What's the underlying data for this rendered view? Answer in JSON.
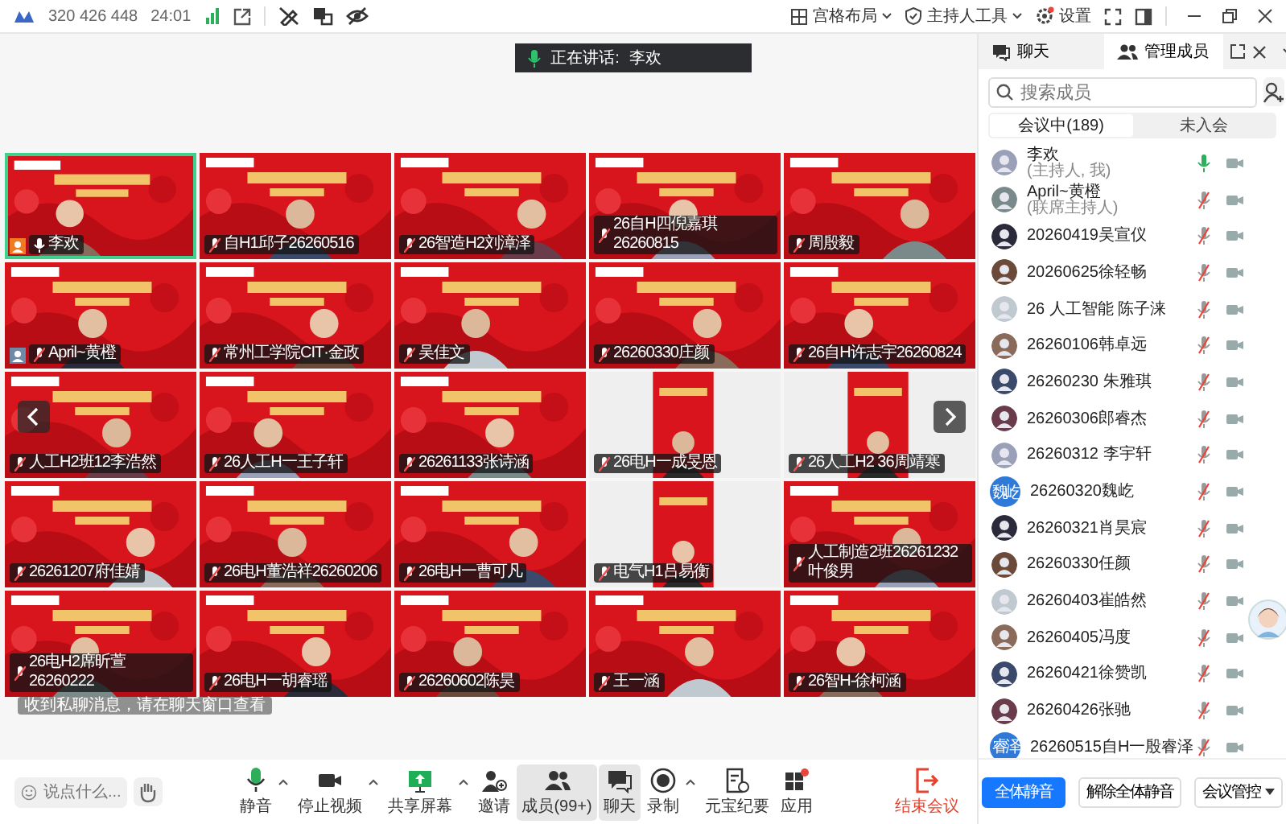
{
  "top_bar": {
    "meeting_id": "320 426 448",
    "duration": "24:01",
    "menus": [
      {
        "kind": "grid",
        "label": "宫格布局",
        "caret": true
      },
      {
        "kind": "shield",
        "label": "主持人工具",
        "caret": true
      },
      {
        "kind": "gear",
        "label": "设置",
        "caret": false
      }
    ]
  },
  "speaking": {
    "label": "正在讲话:",
    "name": "李欢"
  },
  "tiles": [
    {
      "name": "李欢",
      "kind": "full",
      "selected": true,
      "host": true,
      "cohost": false,
      "muted": false
    },
    {
      "name": "自H1邱子26260516",
      "kind": "full",
      "selected": false,
      "host": false,
      "cohost": false,
      "muted": true
    },
    {
      "name": "26智造H2刘漳泽",
      "kind": "full",
      "selected": false,
      "host": false,
      "cohost": false,
      "muted": true
    },
    {
      "name": "26自H四倪嘉琪26260815",
      "kind": "full",
      "selected": false,
      "host": false,
      "cohost": false,
      "muted": true
    },
    {
      "name": "周殷毅",
      "kind": "full",
      "selected": false,
      "host": false,
      "cohost": false,
      "muted": true
    },
    {
      "name": "April~黄橙",
      "kind": "full",
      "selected": false,
      "host": false,
      "cohost": true,
      "muted": true
    },
    {
      "name": "常州工学院CIT·金政",
      "kind": "full",
      "selected": false,
      "host": false,
      "cohost": false,
      "muted": true
    },
    {
      "name": "吴佳文",
      "kind": "full",
      "selected": false,
      "host": false,
      "cohost": false,
      "muted": true
    },
    {
      "name": "26260330庄颜",
      "kind": "full",
      "selected": false,
      "host": false,
      "cohost": false,
      "muted": true
    },
    {
      "name": "26自H许志宇26260824",
      "kind": "full",
      "selected": false,
      "host": false,
      "cohost": false,
      "muted": true
    },
    {
      "name": "人工H2班12李浩然",
      "kind": "full",
      "selected": false,
      "host": false,
      "cohost": false,
      "muted": true
    },
    {
      "name": "26人工H一王子轩",
      "kind": "full",
      "selected": false,
      "host": false,
      "cohost": false,
      "muted": true
    },
    {
      "name": "26261133张诗涵",
      "kind": "full",
      "selected": false,
      "host": false,
      "cohost": false,
      "muted": true
    },
    {
      "name": "26电H一成旻恩",
      "kind": "narrow",
      "selected": false,
      "host": false,
      "cohost": false,
      "muted": true
    },
    {
      "name": "26人工H2 36周靖寒",
      "kind": "narrow",
      "selected": false,
      "host": false,
      "cohost": false,
      "muted": true
    },
    {
      "name": "26261207府佳婧",
      "kind": "full",
      "selected": false,
      "host": false,
      "cohost": false,
      "muted": true
    },
    {
      "name": "26电H董浩祥26260206",
      "kind": "full",
      "selected": false,
      "host": false,
      "cohost": false,
      "muted": true
    },
    {
      "name": "26电H一曹可凡",
      "kind": "full",
      "selected": false,
      "host": false,
      "cohost": false,
      "muted": true
    },
    {
      "name": "电气H1吕易衡",
      "kind": "narrow",
      "selected": false,
      "host": false,
      "cohost": false,
      "muted": true
    },
    {
      "name": "人工制造2班26261232叶俊男",
      "kind": "full",
      "selected": false,
      "host": false,
      "cohost": false,
      "muted": true
    },
    {
      "name": "26电H2席昕萱26260222",
      "kind": "full",
      "selected": false,
      "host": false,
      "cohost": false,
      "muted": true
    },
    {
      "name": "26电H一胡睿瑶",
      "kind": "full",
      "selected": false,
      "host": false,
      "cohost": false,
      "muted": true
    },
    {
      "name": "26260602陈昊",
      "kind": "full",
      "selected": false,
      "host": false,
      "cohost": false,
      "muted": true
    },
    {
      "name": "王一涵",
      "kind": "full",
      "selected": false,
      "host": false,
      "cohost": false,
      "muted": true
    },
    {
      "name": "26智H-徐柯涵",
      "kind": "full",
      "selected": false,
      "host": false,
      "cohost": false,
      "muted": true
    }
  ],
  "toast": "收到私聊消息，请在聊天窗口查看",
  "toolbar": {
    "comment_placeholder": "说点什么...",
    "buttons": [
      {
        "kind": "mic",
        "label": "静音",
        "caret": true,
        "selected": false
      },
      {
        "kind": "video",
        "label": "停止视频",
        "caret": true,
        "selected": false
      },
      {
        "kind": "share",
        "label": "共享屏幕",
        "caret": true,
        "selected": false
      },
      {
        "kind": "invite",
        "label": "邀请",
        "caret": false,
        "selected": false
      },
      {
        "kind": "members",
        "label": "成员(99+)",
        "caret": false,
        "selected": true
      },
      {
        "kind": "chat",
        "label": "聊天",
        "caret": false,
        "selected": true
      },
      {
        "kind": "record",
        "label": "录制",
        "caret": true,
        "selected": false
      },
      {
        "kind": "notes",
        "label": "元宝纪要",
        "caret": false,
        "selected": false
      },
      {
        "kind": "apps",
        "label": "应用",
        "caret": false,
        "selected": false,
        "dot": true
      }
    ],
    "end": "结束会议"
  },
  "panel": {
    "tabs": [
      {
        "kind": "chat",
        "label": "聊天",
        "selected": false
      },
      {
        "kind": "members",
        "label": "管理成员",
        "selected": true
      }
    ],
    "search": {
      "placeholder": "搜索成员"
    },
    "segments": [
      {
        "label": "会议中(189)",
        "selected": true
      },
      {
        "label": "未入会",
        "selected": false
      }
    ],
    "members": [
      {
        "name": "李欢",
        "sub": "(主持人, 我)",
        "kind": "picture",
        "muted": false
      },
      {
        "name": "April~黄橙",
        "sub": "(联席主持人)",
        "kind": "picture",
        "muted": true
      },
      {
        "name": "20260419吴宣仪",
        "kind": "picture",
        "muted": true
      },
      {
        "name": "20260625徐轻畅",
        "kind": "picture",
        "muted": true
      },
      {
        "name": "26 人工智能 陈子涞",
        "kind": "picture",
        "muted": true
      },
      {
        "name": "26260106韩卓远",
        "kind": "picture",
        "muted": true
      },
      {
        "name": "26260230 朱雅琪",
        "kind": "picture",
        "muted": true
      },
      {
        "name": "26260306郎睿杰",
        "kind": "picture",
        "muted": true
      },
      {
        "name": "26260312 李宇轩",
        "kind": "picture",
        "muted": true
      },
      {
        "name": "26260320魏屹",
        "kind": "text",
        "avatar_text": "魏屹",
        "muted": true
      },
      {
        "name": "26260321肖昊宸",
        "kind": "picture",
        "muted": true
      },
      {
        "name": "26260330任颜",
        "kind": "picture",
        "muted": true
      },
      {
        "name": "26260403崔皓然",
        "kind": "picture",
        "muted": true
      },
      {
        "name": "26260405冯度",
        "kind": "picture",
        "muted": true
      },
      {
        "name": "26260421徐赞凯",
        "kind": "picture",
        "muted": true
      },
      {
        "name": "26260426张驰",
        "kind": "picture",
        "muted": true
      },
      {
        "name": "26260515自H一殷睿泽",
        "kind": "text",
        "avatar_text": "睿泽",
        "muted": true
      }
    ],
    "buttons": [
      {
        "kind": "primary",
        "label": "全体静音",
        "caret": false
      },
      {
        "kind": "plain",
        "label": "解除全体静音",
        "caret": false
      },
      {
        "kind": "plain",
        "label": "会议管控",
        "caret": true
      }
    ]
  }
}
